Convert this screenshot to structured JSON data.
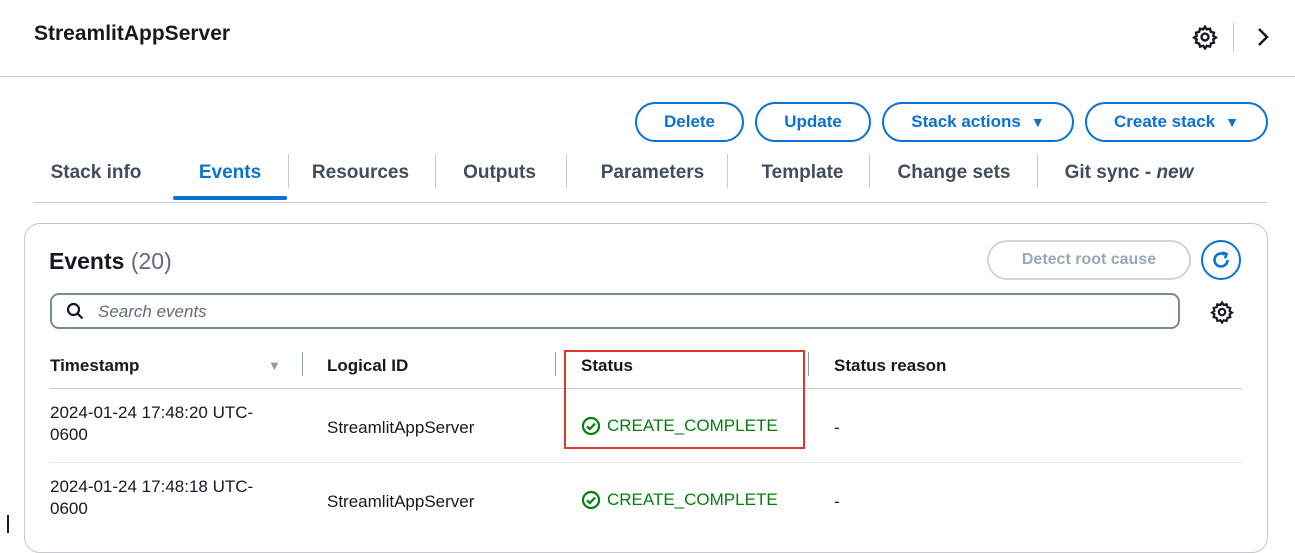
{
  "header": {
    "title": "StreamlitAppServer"
  },
  "actions": {
    "delete": "Delete",
    "update": "Update",
    "stack_actions": "Stack actions",
    "create_stack": "Create stack"
  },
  "tabs": [
    {
      "label": "Stack info"
    },
    {
      "label": "Events",
      "active": true
    },
    {
      "label": "Resources"
    },
    {
      "label": "Outputs"
    },
    {
      "label": "Parameters"
    },
    {
      "label": "Template"
    },
    {
      "label": "Change sets"
    },
    {
      "label": "Git sync - ",
      "label_suffix": "new"
    }
  ],
  "events": {
    "title": "Events",
    "count": "(20)",
    "detect_root_cause": "Detect root cause",
    "search_placeholder": "Search events",
    "columns": [
      "Timestamp",
      "Logical ID",
      "Status",
      "Status reason"
    ],
    "rows": [
      {
        "timestamp_1": "2024-01-24 17:48:20 UTC-",
        "timestamp_2": "0600",
        "logical_id": "StreamlitAppServer",
        "status": "CREATE_COMPLETE",
        "reason": "-"
      },
      {
        "timestamp_1": "2024-01-24 17:48:18 UTC-",
        "timestamp_2": "0600",
        "logical_id": "StreamlitAppServer",
        "status": "CREATE_COMPLETE",
        "reason": "-"
      }
    ]
  },
  "colors": {
    "accent": "#0972d3",
    "success": "#037f0c",
    "highlight": "#e0362c"
  }
}
